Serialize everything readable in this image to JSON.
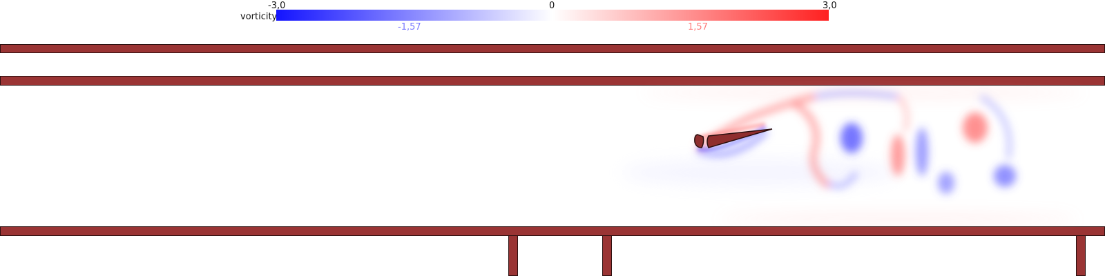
{
  "colorbar": {
    "title": "vorticity",
    "min_label": "-3,0",
    "mid_label": "0",
    "max_label": "3,0",
    "neg_tick": "-1,57",
    "pos_tick": "1,57",
    "colors": {
      "negative": "#1414ff",
      "zero": "#ffffff",
      "positive": "#ff2020",
      "neg_tick_color": "#7a7aff",
      "pos_tick_color": "#ff7a7a"
    }
  },
  "walls": {
    "color": "#9a3434",
    "outline": "#2b0f0f"
  },
  "obstacle": {
    "color": "#8f2e2e"
  }
}
